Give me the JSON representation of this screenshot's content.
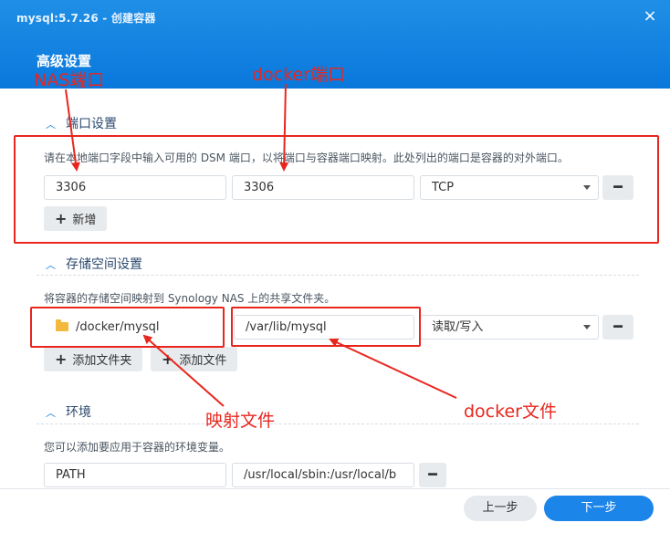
{
  "window": {
    "title": "mysql:5.7.26 - 创建容器",
    "close_label": "×"
  },
  "page_title": "高级设置",
  "ports": {
    "header": "端口设置",
    "description": "请在本地端口字段中输入可用的 DSM 端口，以将端口与容器端口映射。此处列出的端口是容器的对外端口。",
    "local_port": "3306",
    "container_port": "3306",
    "protocol": "TCP",
    "add_label": "新增"
  },
  "storage": {
    "header": "存储空间设置",
    "description": "将容器的存储空间映射到 Synology NAS 上的共享文件夹。",
    "folder": "/docker/mysql",
    "mount_path": "/var/lib/mysql",
    "permission": "读取/写入",
    "add_folder_label": "添加文件夹",
    "add_file_label": "添加文件"
  },
  "env": {
    "header": "环境",
    "description": "您可以添加要应用于容器的环境变量。",
    "variable": "PATH",
    "value": "/usr/local/sbin:/usr/local/b"
  },
  "footer": {
    "prev_label": "上一步",
    "next_label": "下一步"
  },
  "annotations": {
    "nas_port": "NAS端口",
    "docker_port": "docker端口",
    "mapped_file": "映射文件",
    "docker_file": "docker文件"
  },
  "colors": {
    "accent": "#1b85ea",
    "annotation": "#e8261e",
    "folder": "#f3b93c"
  }
}
